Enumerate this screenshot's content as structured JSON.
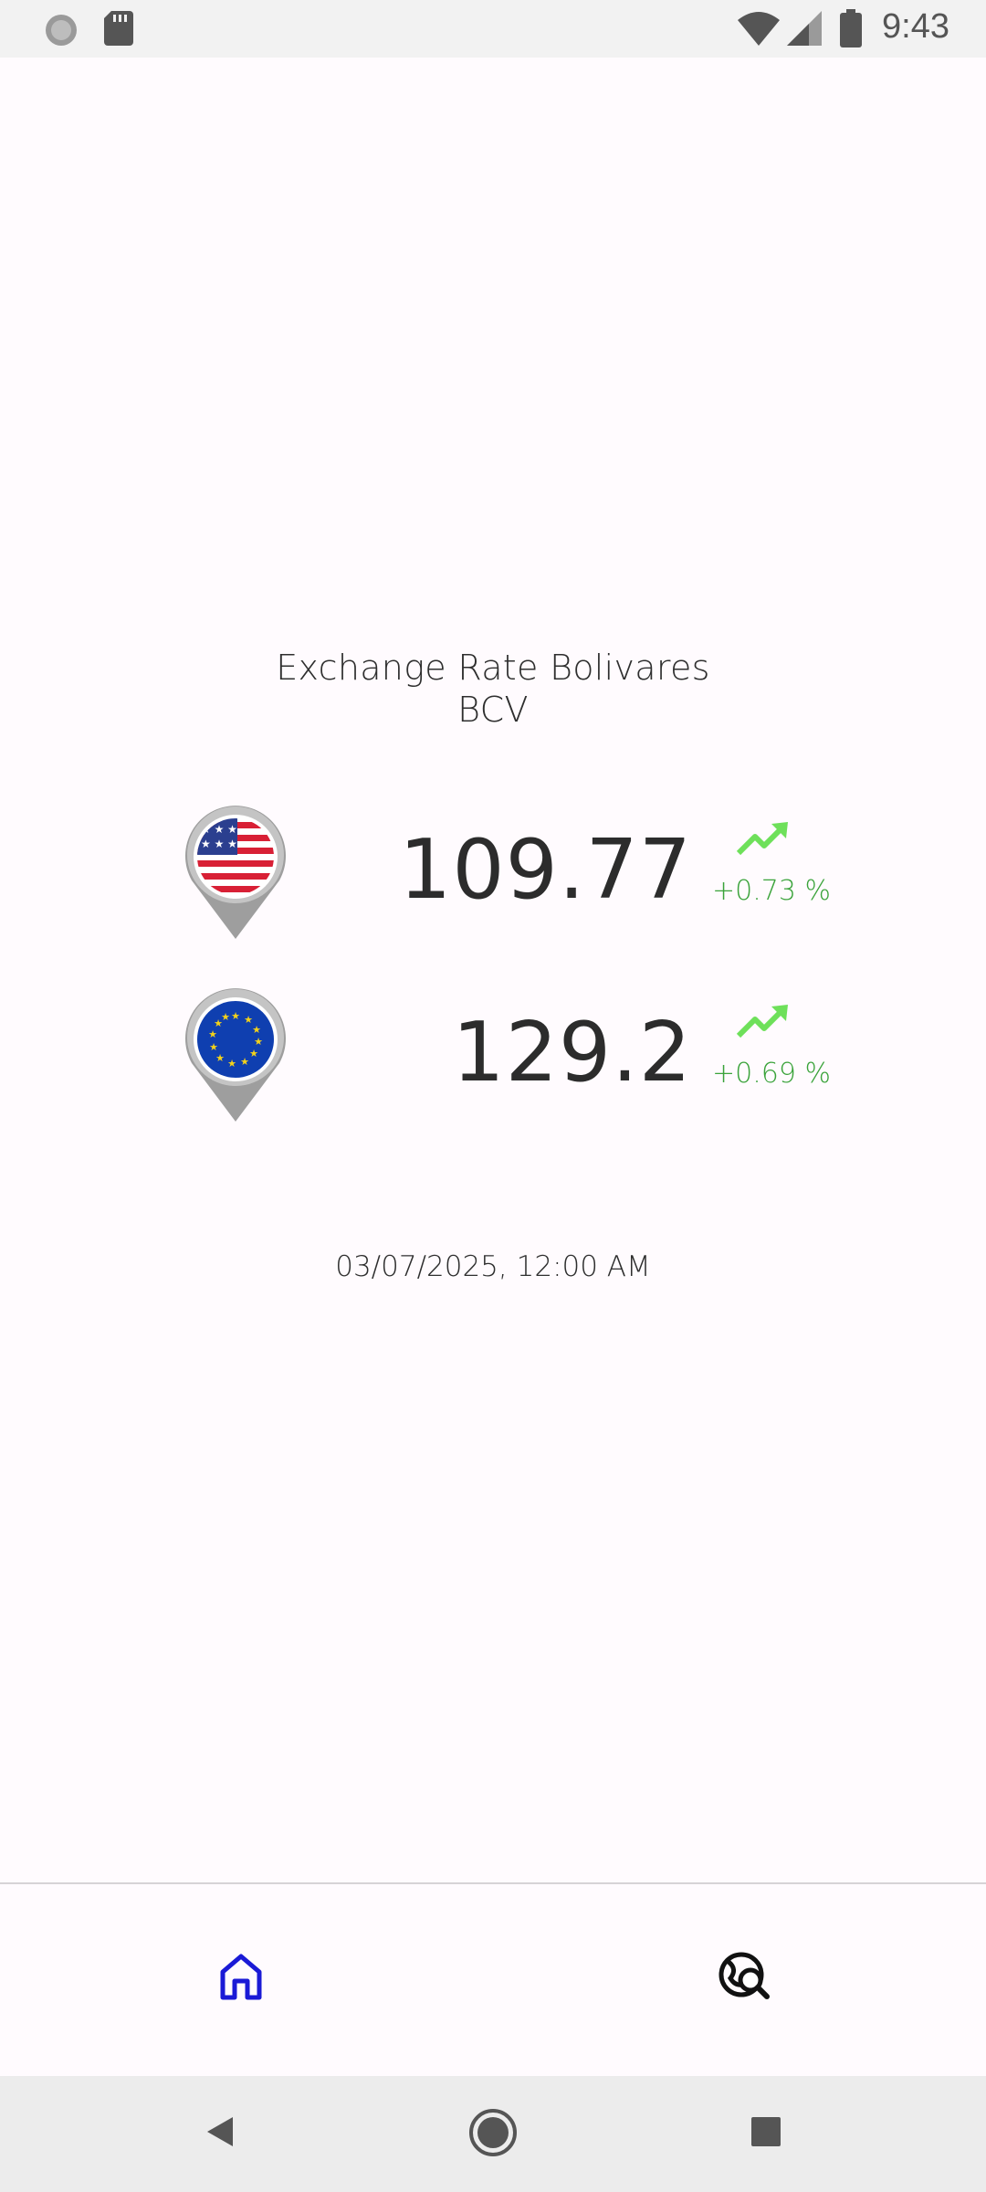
{
  "status_bar": {
    "time": "9:43",
    "icons": [
      "loading-icon",
      "sd-card-icon",
      "wifi-icon",
      "signal-icon",
      "battery-icon"
    ]
  },
  "header": {
    "title_line1": "Exchange Rate Bolivares",
    "title_line2": "BCV"
  },
  "rates": [
    {
      "currency_icon": "usa-flag-pin-icon",
      "value": "109.77",
      "trend_icon": "trending-up-icon",
      "change": "+0.73 %"
    },
    {
      "currency_icon": "eu-flag-pin-icon",
      "value": "129.2",
      "trend_icon": "trending-up-icon",
      "change": "+0.69 %"
    }
  ],
  "timestamp": "03/07/2025, 12:00 AM",
  "bottom_nav": {
    "items": [
      {
        "icon": "home-icon",
        "active": true
      },
      {
        "icon": "globe-search-icon",
        "active": false
      }
    ]
  },
  "colors": {
    "background": "#fffbfe",
    "active_nav": "#1a1ad6",
    "trend_up": "#6ee05a",
    "change_text": "#3aa33a"
  }
}
